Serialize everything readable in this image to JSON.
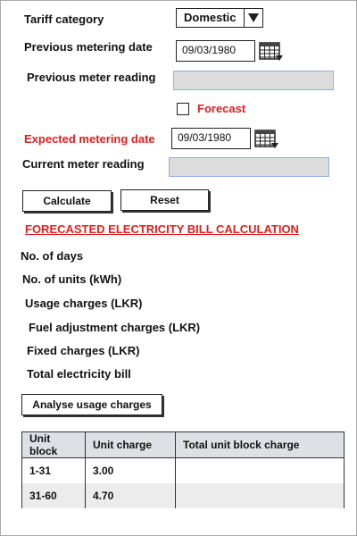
{
  "form": {
    "tariff_label": "Tariff category",
    "tariff_value": "Domestic",
    "prev_date_label": "Previous metering date",
    "prev_date_value": "09/03/1980",
    "prev_reading_label": "Previous meter reading",
    "prev_reading_value": "",
    "forecast_label": "Forecast",
    "forecast_checked": false,
    "expected_date_label": "Expected metering date",
    "expected_date_value": "09/03/1980",
    "current_reading_label": "Current meter reading",
    "current_reading_value": "",
    "calculate_label": "Calculate",
    "reset_label": "Reset"
  },
  "result": {
    "title": "FORECASTED ELECTRICITY BILL CALCULATION",
    "rows": [
      "No. of days",
      "No. of units (kWh)",
      "Usage charges (LKR)",
      "Fuel adjustment charges (LKR)",
      "Fixed charges (LKR)",
      "Total electricity bill"
    ],
    "analyse_label": "Analyse usage charges"
  },
  "table": {
    "headers": [
      "Unit block",
      "Unit charge",
      "Total unit block charge"
    ],
    "rows": [
      [
        "1-31",
        "3.00",
        ""
      ],
      [
        "31-60",
        "4.70",
        ""
      ]
    ]
  },
  "colors": {
    "accent_red": "#e01e1e",
    "input_border": "#8fb2e6",
    "input_fill": "#dcdcdc"
  },
  "icons": {
    "dropdown": "triangle-down-icon",
    "calendar": "calendar-icon"
  }
}
